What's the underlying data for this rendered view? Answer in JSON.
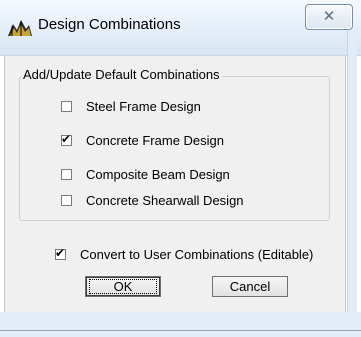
{
  "window": {
    "title": "Design Combinations",
    "close_glyph": "✕",
    "app_icon": "etabs-app-icon"
  },
  "group": {
    "legend": "Add/Update Default Combinations",
    "options": [
      {
        "label": "Steel Frame Design",
        "checked": false,
        "mark": ""
      },
      {
        "label": "Concrete Frame Design",
        "checked": true,
        "mark": "✔"
      },
      {
        "label": "Composite Beam Design",
        "checked": false,
        "mark": ""
      },
      {
        "label": "Concrete Shearwall Design",
        "checked": false,
        "mark": ""
      }
    ]
  },
  "convert": {
    "label": "Convert to User Combinations (Editable)",
    "checked": true,
    "mark": "✔"
  },
  "buttons": {
    "ok_label": "OK",
    "cancel_label": "Cancel"
  },
  "colors": {
    "dialog_background": "#f0f0f0",
    "titlebar_top": "#f4f9fe",
    "titlebar_bottom": "#d8e5f3"
  }
}
